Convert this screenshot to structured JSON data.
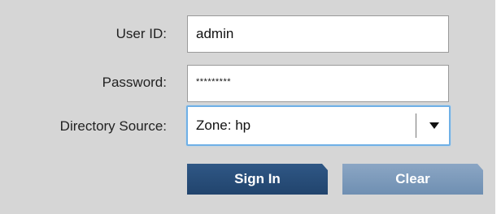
{
  "form": {
    "user_id": {
      "label": "User ID:",
      "value": "admin"
    },
    "password": {
      "label": "Password:",
      "value": "*********"
    },
    "directory_source": {
      "label": "Directory Source:",
      "value": "Zone: hp"
    }
  },
  "buttons": {
    "sign_in": "Sign In",
    "clear": "Clear"
  },
  "colors": {
    "panel_bg": "#d6d6d6",
    "sign_in_bg": "#2b5180",
    "clear_bg": "#7f9dbf",
    "focus_border": "#6fb0e6"
  }
}
